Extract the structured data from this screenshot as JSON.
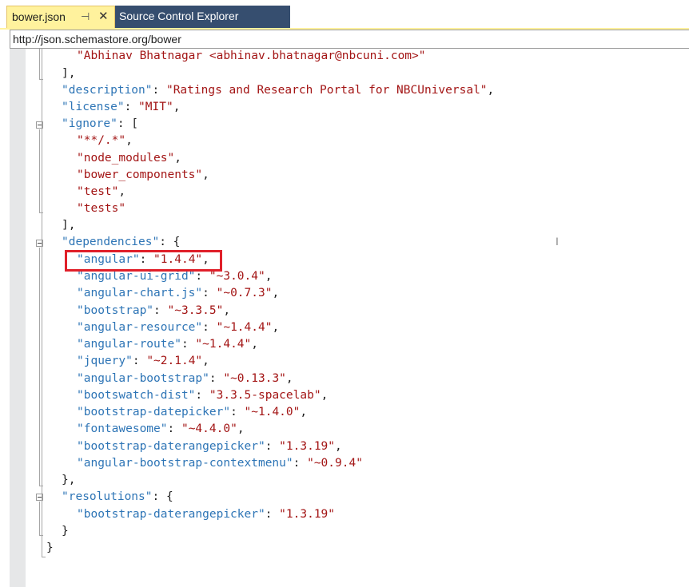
{
  "tabs": {
    "active": {
      "label": "bower.json",
      "pin_icon": "pin-icon",
      "close_icon": "close-icon",
      "pin_glyph": "⊣",
      "close_glyph": "✕"
    },
    "inactive": {
      "label": "Source Control Explorer"
    }
  },
  "schema": {
    "url": "http://json.schemastore.org/bower"
  },
  "colors": {
    "key": "#2e75b6",
    "string": "#a31515",
    "active_tab": "#fff29d",
    "inactive_tab": "#364e6f",
    "highlight_box": "#e0202a"
  },
  "code": {
    "author_line": "\"Abhinav Bhatnagar <abhinav.bhatnagar@nbcuni.com>\"",
    "close_array_1": "],",
    "description_key": "\"description\"",
    "description_value": "\"Ratings and Research Portal for NBCUniversal\"",
    "license_key": "\"license\"",
    "license_value": "\"MIT\"",
    "ignore_key": "\"ignore\"",
    "ignore_items": [
      "\"**/.*\"",
      "\"node_modules\"",
      "\"bower_components\"",
      "\"test\"",
      "\"tests\""
    ],
    "close_array_2": "],",
    "dependencies_key": "\"dependencies\"",
    "dependencies": [
      {
        "key": "\"angular\"",
        "value": "\"1.4.4\""
      },
      {
        "key": "\"angular-ui-grid\"",
        "value": "\"~3.0.4\""
      },
      {
        "key": "\"angular-chart.js\"",
        "value": "\"~0.7.3\""
      },
      {
        "key": "\"bootstrap\"",
        "value": "\"~3.3.5\""
      },
      {
        "key": "\"angular-resource\"",
        "value": "\"~1.4.4\""
      },
      {
        "key": "\"angular-route\"",
        "value": "\"~1.4.4\""
      },
      {
        "key": "\"jquery\"",
        "value": "\"~2.1.4\""
      },
      {
        "key": "\"angular-bootstrap\"",
        "value": "\"~0.13.3\""
      },
      {
        "key": "\"bootswatch-dist\"",
        "value": "\"3.3.5-spacelab\""
      },
      {
        "key": "\"bootstrap-datepicker\"",
        "value": "\"~1.4.0\""
      },
      {
        "key": "\"fontawesome\"",
        "value": "\"~4.4.0\""
      },
      {
        "key": "\"bootstrap-daterangepicker\"",
        "value": "\"1.3.19\""
      },
      {
        "key": "\"angular-bootstrap-contextmenu\"",
        "value": "\"~0.9.4\""
      }
    ],
    "close_object_1": "},",
    "resolutions_key": "\"resolutions\"",
    "resolutions": [
      {
        "key": "\"bootstrap-daterangepicker\"",
        "value": "\"1.3.19\""
      }
    ],
    "close_object_2": "}",
    "close_root": "}"
  }
}
